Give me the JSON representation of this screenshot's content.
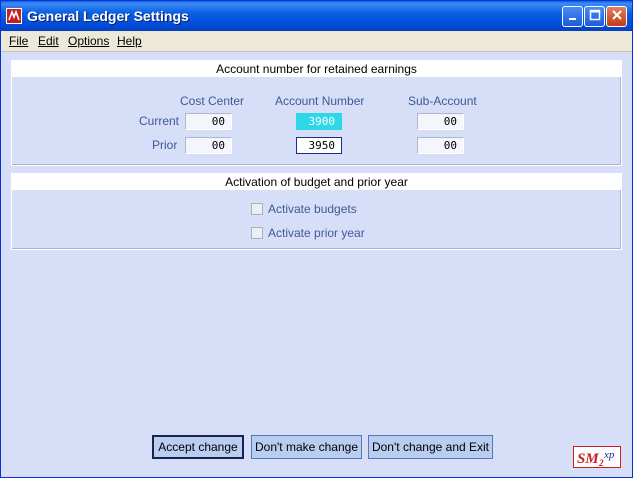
{
  "window": {
    "title": "General Ledger Settings"
  },
  "menu": [
    "File",
    "Edit",
    "Options",
    "Help"
  ],
  "retained": {
    "heading": "Account number for retained earnings",
    "columns": [
      "Cost Center",
      "Account Number",
      "Sub-Account"
    ],
    "rows": [
      {
        "label": "Current",
        "cost_center": "00",
        "account": "3900",
        "sub_account": "00"
      },
      {
        "label": "Prior",
        "cost_center": "00",
        "account": "3950",
        "sub_account": "00"
      }
    ]
  },
  "activation": {
    "heading": "Activation of budget and prior year",
    "budgets_label": "Activate budgets",
    "budgets_checked": false,
    "prior_label": "Activate prior year",
    "prior_checked": false
  },
  "buttons": {
    "accept": "Accept change",
    "dont_make": "Don't make change",
    "dont_exit": "Don't change and Exit"
  },
  "logo": {
    "text": "SM2xp",
    "color": "#cc2020"
  },
  "colors": {
    "titlebar": "#0a5fe3",
    "background": "#d6dff7",
    "highlight": "#2fd8e8",
    "label": "#3d5a96"
  }
}
